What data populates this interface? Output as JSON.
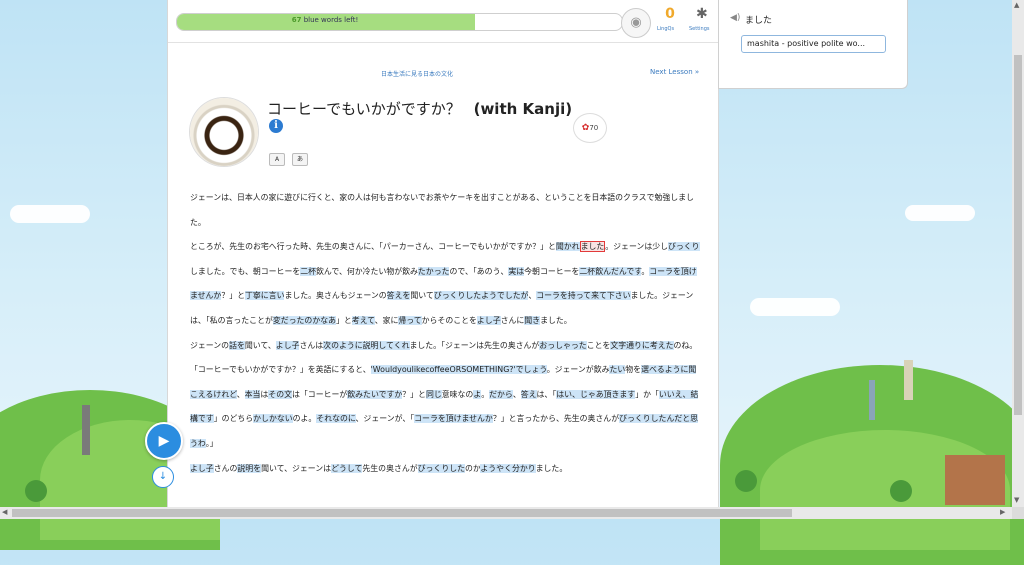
{
  "progress": {
    "count": "67",
    "label": "blue words left!",
    "fraction": 0.67
  },
  "header": {
    "lingqs_count": "0",
    "lingqs_label": "LingQs",
    "settings_label": "Settings"
  },
  "course_link": "日本生活に見る日本の文化",
  "next_lesson": "Next Lesson »",
  "lesson": {
    "title": "コーヒーでもいかがですか？",
    "title_suffix": "(with Kanji)",
    "toggle_romaji": "A",
    "toggle_kana": "あ",
    "likes": "70"
  },
  "paragraphs": [
    [
      {
        "t": "ジェーンは、日本人の家に遊びに行くと、家の人は何も言わないでお茶やケーキを出すことがある、ということを日本語のクラスで勉強しました。",
        "h": 0
      }
    ],
    [
      {
        "t": "ところが、先生のお宅へ行った時、先生の奥さんに、「パーカーさん、コーヒーでもいかがですか？」と",
        "h": 0
      },
      {
        "t": "聞かれ",
        "h": 1
      },
      {
        "t": "ました",
        "h": 2
      },
      {
        "t": "。ジェーンは少し",
        "h": 0
      },
      {
        "t": "びっくり",
        "h": 1
      },
      {
        "t": "しました。でも、朝コーヒーを",
        "h": 0
      },
      {
        "t": "二杯",
        "h": 1
      },
      {
        "t": "飲んで、何か冷たい物が飲み",
        "h": 0
      },
      {
        "t": "たかった",
        "h": 1
      },
      {
        "t": "ので、「あのう、",
        "h": 0
      },
      {
        "t": "実は",
        "h": 1
      },
      {
        "t": "今朝コーヒーを",
        "h": 0
      },
      {
        "t": "二杯飲んだんです",
        "h": 1
      },
      {
        "t": "。",
        "h": 0
      },
      {
        "t": "コーラを頂けませんか",
        "h": 1
      },
      {
        "t": "？」と",
        "h": 0
      },
      {
        "t": "丁寧に言い",
        "h": 1
      },
      {
        "t": "ました。奥さんもジェーンの",
        "h": 0
      },
      {
        "t": "答えを",
        "h": 1
      },
      {
        "t": "聞いて",
        "h": 0
      },
      {
        "t": "びっくりしたようでしたが",
        "h": 1
      },
      {
        "t": "、",
        "h": 0
      },
      {
        "t": "コーラを持って来て下さい",
        "h": 1
      },
      {
        "t": "ました。ジェーンは、「私の言ったことが",
        "h": 0
      },
      {
        "t": "変だったのかなあ",
        "h": 1
      },
      {
        "t": "」と",
        "h": 0
      },
      {
        "t": "考えて",
        "h": 1
      },
      {
        "t": "、家に",
        "h": 0
      },
      {
        "t": "帰って",
        "h": 1
      },
      {
        "t": "からそのことを",
        "h": 0
      },
      {
        "t": "よし子",
        "h": 1
      },
      {
        "t": "さんに",
        "h": 0
      },
      {
        "t": "聞き",
        "h": 1
      },
      {
        "t": "ました。",
        "h": 0
      }
    ],
    [
      {
        "t": "ジェーンの",
        "h": 0
      },
      {
        "t": "話を",
        "h": 1
      },
      {
        "t": "聞いて、",
        "h": 0
      },
      {
        "t": "よし子",
        "h": 1
      },
      {
        "t": "さんは",
        "h": 0
      },
      {
        "t": "次のように説明してくれ",
        "h": 1
      },
      {
        "t": "ました。「ジェーンは先生の奥さんが",
        "h": 0
      },
      {
        "t": "おっしゃった",
        "h": 1
      },
      {
        "t": "ことを",
        "h": 0
      },
      {
        "t": "文字通りに考えた",
        "h": 1
      },
      {
        "t": "のね。「コーヒーでもいかがですか？」を英語にすると、",
        "h": 0
      },
      {
        "t": "'WouldyoulikecoffeeORSOMETHING?'でしょう",
        "h": 1
      },
      {
        "t": "。ジェーンが飲み",
        "h": 0
      },
      {
        "t": "たい",
        "h": 1
      },
      {
        "t": "物を",
        "h": 0
      },
      {
        "t": "選べるように聞こえるけれど",
        "h": 1
      },
      {
        "t": "、",
        "h": 0
      },
      {
        "t": "本当",
        "h": 1
      },
      {
        "t": "は",
        "h": 0
      },
      {
        "t": "その文",
        "h": 1
      },
      {
        "t": "は「コーヒーが",
        "h": 0
      },
      {
        "t": "飲みたいですか",
        "h": 1
      },
      {
        "t": "？」と",
        "h": 0
      },
      {
        "t": "同じ",
        "h": 1
      },
      {
        "t": "意味なの",
        "h": 0
      },
      {
        "t": "よ",
        "h": 1
      },
      {
        "t": "。",
        "h": 0
      },
      {
        "t": "だから",
        "h": 1
      },
      {
        "t": "、",
        "h": 0
      },
      {
        "t": "答え",
        "h": 1
      },
      {
        "t": "は、「",
        "h": 0
      },
      {
        "t": "はい、じゃあ頂きます",
        "h": 1
      },
      {
        "t": "」か「",
        "h": 0
      },
      {
        "t": "いいえ、結構です",
        "h": 1
      },
      {
        "t": "」のどちら",
        "h": 0
      },
      {
        "t": "かしかない",
        "h": 1
      },
      {
        "t": "のよ。",
        "h": 0
      },
      {
        "t": "それなのに",
        "h": 1
      },
      {
        "t": "、ジェーンが、「",
        "h": 0
      },
      {
        "t": "コーラを頂けませんか",
        "h": 1
      },
      {
        "t": "？」と言ったから、先生の奥さんが",
        "h": 0
      },
      {
        "t": "びっくりしたんだと思うわ",
        "h": 1
      },
      {
        "t": "。」",
        "h": 0
      }
    ],
    [
      {
        "t": "よし子",
        "h": 1
      },
      {
        "t": "さんの",
        "h": 0
      },
      {
        "t": "説明を",
        "h": 1
      },
      {
        "t": "聞いて、ジェーンは",
        "h": 0
      },
      {
        "t": "どうして",
        "h": 1
      },
      {
        "t": "先生の奥さんが",
        "h": 0
      },
      {
        "t": "びっくりした",
        "h": 1
      },
      {
        "t": "のか",
        "h": 0
      },
      {
        "t": "ようやく分かり",
        "h": 1
      },
      {
        "t": "ました。",
        "h": 0
      }
    ]
  ],
  "sidebar": {
    "word": "ました",
    "hint": "mashita - positive polite wo..."
  }
}
